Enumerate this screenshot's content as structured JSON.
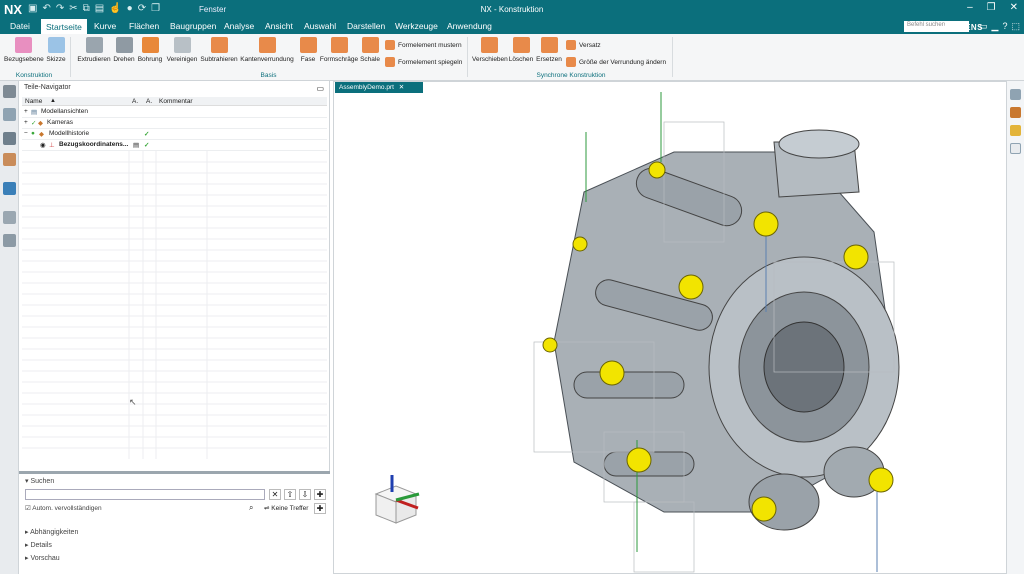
{
  "title_bar": {
    "logo": "NX",
    "window_menu": "Fenster",
    "title": "NX - Konstruktion"
  },
  "menu": {
    "tabs": [
      "Datei",
      "Startseite",
      "Kurve",
      "Flächen",
      "Baugruppen",
      "Analyse",
      "Ansicht",
      "Auswahl",
      "Darstellen",
      "Werkzeuge",
      "Anwendung"
    ],
    "active": "Startseite",
    "search_placeholder": "Befehl suchen",
    "brand": "SIEMENS"
  },
  "ribbon": {
    "konstruktion": {
      "label": "Konstruktion",
      "items": [
        "Bezugsebene",
        "Skizze"
      ]
    },
    "basis": {
      "label": "Basis",
      "items": [
        "Extrudieren",
        "Drehen",
        "Bohrung",
        "Vereinigen",
        "Subtrahieren",
        "Kantenverrundung",
        "Fase",
        "Formschräge",
        "Schale"
      ],
      "small": [
        "Formelement mustern",
        "Formelement spiegeln"
      ]
    },
    "synchrone": {
      "label": "Synchrone Konstruktion",
      "items": [
        "Verschieben",
        "Löschen",
        "Ersetzen"
      ],
      "small": [
        "Versatz",
        "Größe der Verrundung ändern"
      ]
    }
  },
  "navigator": {
    "title": "Teile-Navigator",
    "columns": [
      "Name",
      "A.",
      "A.",
      "Kommentar"
    ],
    "rows": [
      {
        "label": "Modellansichten",
        "check": ""
      },
      {
        "label": "Kameras",
        "check": ""
      },
      {
        "label": "Modellhistorie",
        "check": "✓"
      },
      {
        "label": "Bezugskoordinatens...",
        "check": "✓"
      }
    ]
  },
  "search_panel": {
    "title": "Suchen",
    "autocomplete": "Autom. vervollständigen",
    "no_hits": "Keine Treffer",
    "sections": [
      "Abhängigkeiten",
      "Details",
      "Vorschau"
    ]
  },
  "document_tab": "AssemblyDemo.prt",
  "colors": {
    "brand": "#0b6f7c",
    "highlight": "#f2e400"
  }
}
